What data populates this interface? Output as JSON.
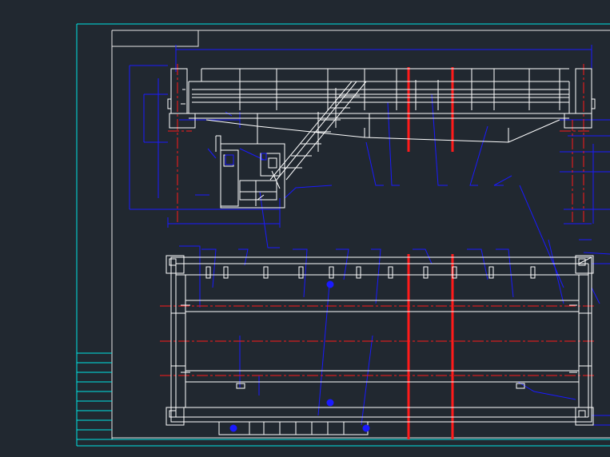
{
  "canvas": {
    "background": "#212830"
  },
  "colors": {
    "frame": "#00e5e5",
    "geometry": "#ffffff",
    "dimension": "#1a1aff",
    "centerline": "#ff1a1a",
    "sheet_border": "#e6e6e6"
  },
  "views": [
    {
      "id": "elevation-view",
      "description_visible": false
    },
    {
      "id": "plan-view",
      "description_visible": false
    }
  ],
  "title_block": {
    "rows": 9
  }
}
